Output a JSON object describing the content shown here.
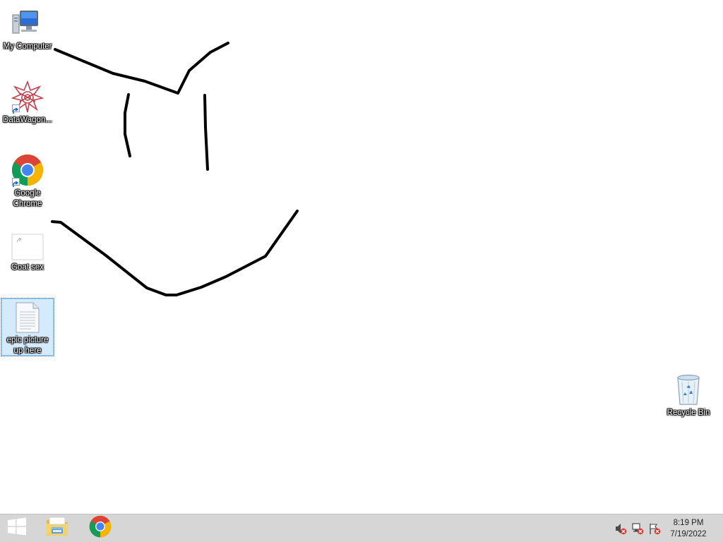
{
  "desktop": {
    "icons": [
      {
        "label": "My Computer",
        "icon": "computer-icon"
      },
      {
        "label": "DataWagon...",
        "icon": "datawagon-star-icon"
      },
      {
        "label": "Google Chrome",
        "icon": "chrome-icon"
      },
      {
        "label": "Goat sex",
        "icon": "blank-image-file-icon"
      },
      {
        "label": "epic picture up here",
        "icon": "text-document-icon",
        "selected": true
      },
      {
        "label": "Recycle Bin",
        "icon": "recycle-bin-icon"
      }
    ],
    "drawing_color": "#000000"
  },
  "taskbar": {
    "start": {
      "icon": "windows-start-icon"
    },
    "pinned": [
      {
        "icon": "file-explorer-icon"
      },
      {
        "icon": "chrome-icon"
      }
    ],
    "tray": [
      {
        "icon": "speaker-muted-icon"
      },
      {
        "icon": "network-error-icon"
      },
      {
        "icon": "action-center-flag-icon"
      }
    ],
    "clock": {
      "time": "8:19 PM",
      "date": "7/19/2022"
    }
  }
}
